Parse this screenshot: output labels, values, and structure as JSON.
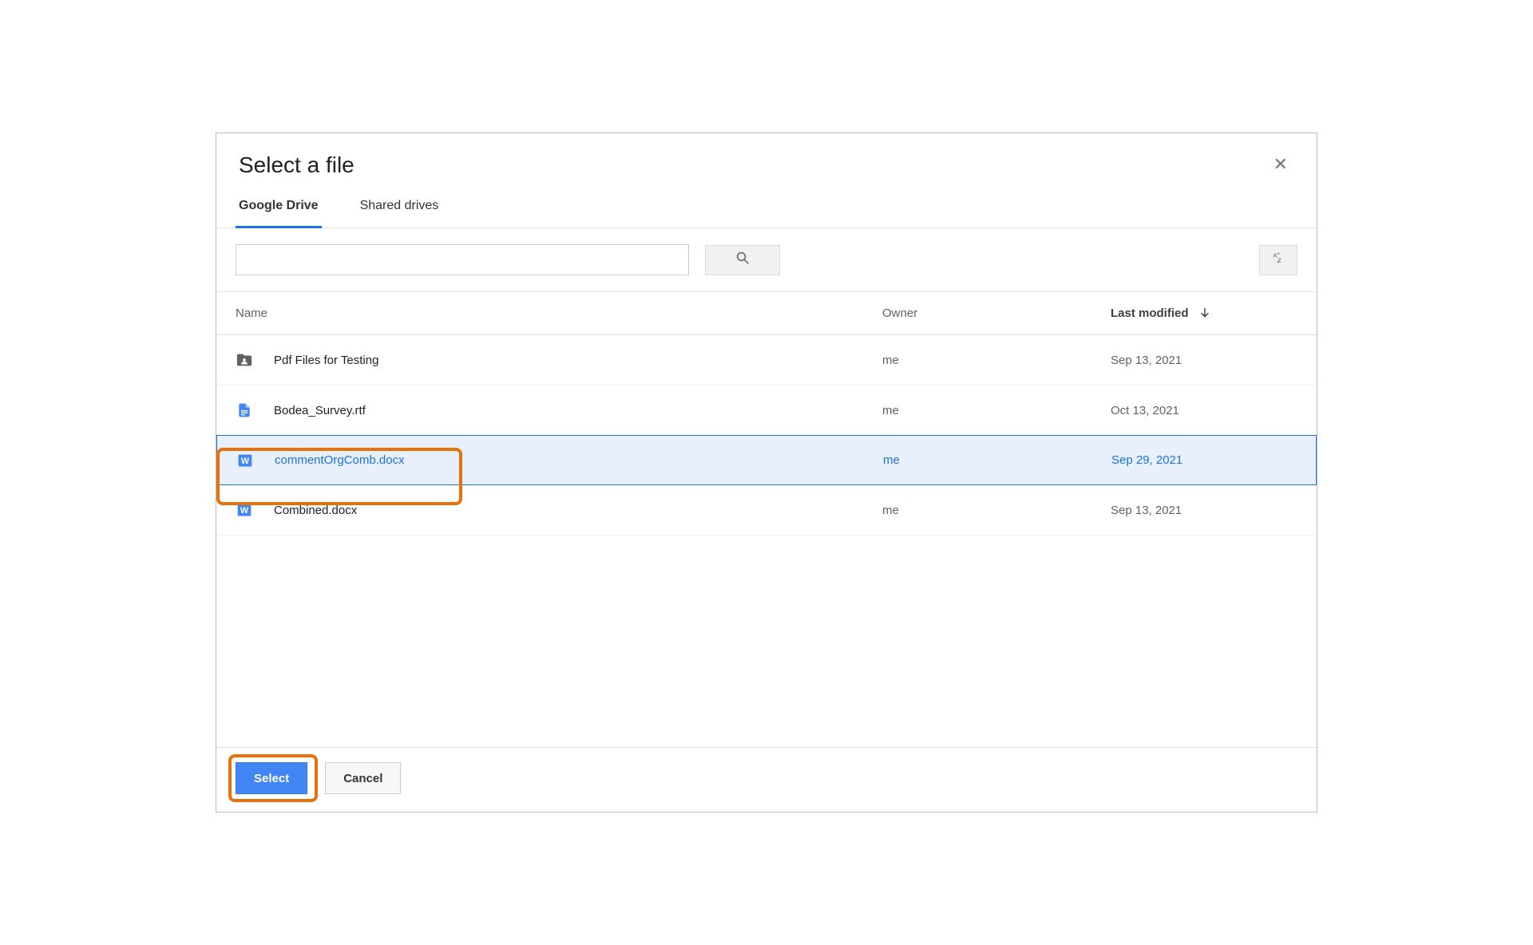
{
  "dialog": {
    "title": "Select a file",
    "tabs": [
      {
        "label": "Google Drive",
        "active": true
      },
      {
        "label": "Shared drives",
        "active": false
      }
    ],
    "columns": {
      "name": "Name",
      "owner": "Owner",
      "modified": "Last modified"
    },
    "files": [
      {
        "icon": "folder-shared-icon",
        "name": "Pdf Files for Testing",
        "owner": "me",
        "modified": "Sep 13, 2021",
        "selected": false
      },
      {
        "icon": "docs-icon",
        "name": "Bodea_Survey.rtf",
        "owner": "me",
        "modified": "Oct 13, 2021",
        "selected": false
      },
      {
        "icon": "word-icon",
        "name": "commentOrgComb.docx",
        "owner": "me",
        "modified": "Sep 29, 2021",
        "selected": true
      },
      {
        "icon": "word-icon",
        "name": "Combined.docx",
        "owner": "me",
        "modified": "Sep 13, 2021",
        "selected": false
      }
    ],
    "buttons": {
      "select": "Select",
      "cancel": "Cancel"
    }
  }
}
